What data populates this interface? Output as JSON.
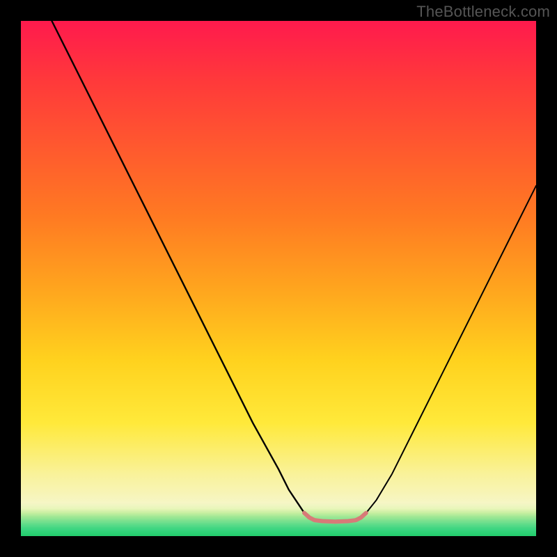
{
  "watermark": {
    "text": "TheBottleneck.com"
  },
  "chart_data": {
    "type": "line",
    "title": "",
    "xlabel": "",
    "ylabel": "",
    "xlim": [
      0,
      100
    ],
    "ylim": [
      0,
      100
    ],
    "grid": false,
    "legend": false,
    "annotations": [],
    "background": {
      "gradient_stops_top_to_bottom": [
        {
          "pct": 0,
          "color": "#ff1a4d"
        },
        {
          "pct": 25,
          "color": "#ff5a2e"
        },
        {
          "pct": 52,
          "color": "#ffa51e"
        },
        {
          "pct": 78,
          "color": "#ffe93a"
        },
        {
          "pct": 94,
          "color": "#f6f6c8"
        },
        {
          "pct": 100,
          "color": "#22cc6b"
        }
      ]
    },
    "series": [
      {
        "name": "bottleneck-curve-left",
        "stroke": "#000000",
        "points_xy": [
          [
            6,
            100
          ],
          [
            10,
            92
          ],
          [
            15,
            82
          ],
          [
            20,
            72
          ],
          [
            25,
            62
          ],
          [
            30,
            52
          ],
          [
            35,
            42
          ],
          [
            40,
            32
          ],
          [
            45,
            22
          ],
          [
            50,
            13
          ],
          [
            52,
            9
          ],
          [
            54,
            6
          ],
          [
            55,
            4.5
          ]
        ]
      },
      {
        "name": "bottleneck-curve-right",
        "stroke": "#000000",
        "points_xy": [
          [
            67,
            4.5
          ],
          [
            69,
            7
          ],
          [
            72,
            12
          ],
          [
            76,
            20
          ],
          [
            80,
            28
          ],
          [
            84,
            36
          ],
          [
            88,
            44
          ],
          [
            92,
            52
          ],
          [
            96,
            60
          ],
          [
            100,
            68
          ]
        ]
      },
      {
        "name": "optimal-flat-zone",
        "stroke": "#d77a78",
        "points_xy": [
          [
            55,
            4.5
          ],
          [
            56,
            3.6
          ],
          [
            57,
            3.1
          ],
          [
            58.5,
            2.9
          ],
          [
            61,
            2.8
          ],
          [
            63.5,
            2.9
          ],
          [
            65,
            3.1
          ],
          [
            66,
            3.6
          ],
          [
            67,
            4.5
          ]
        ]
      }
    ]
  }
}
